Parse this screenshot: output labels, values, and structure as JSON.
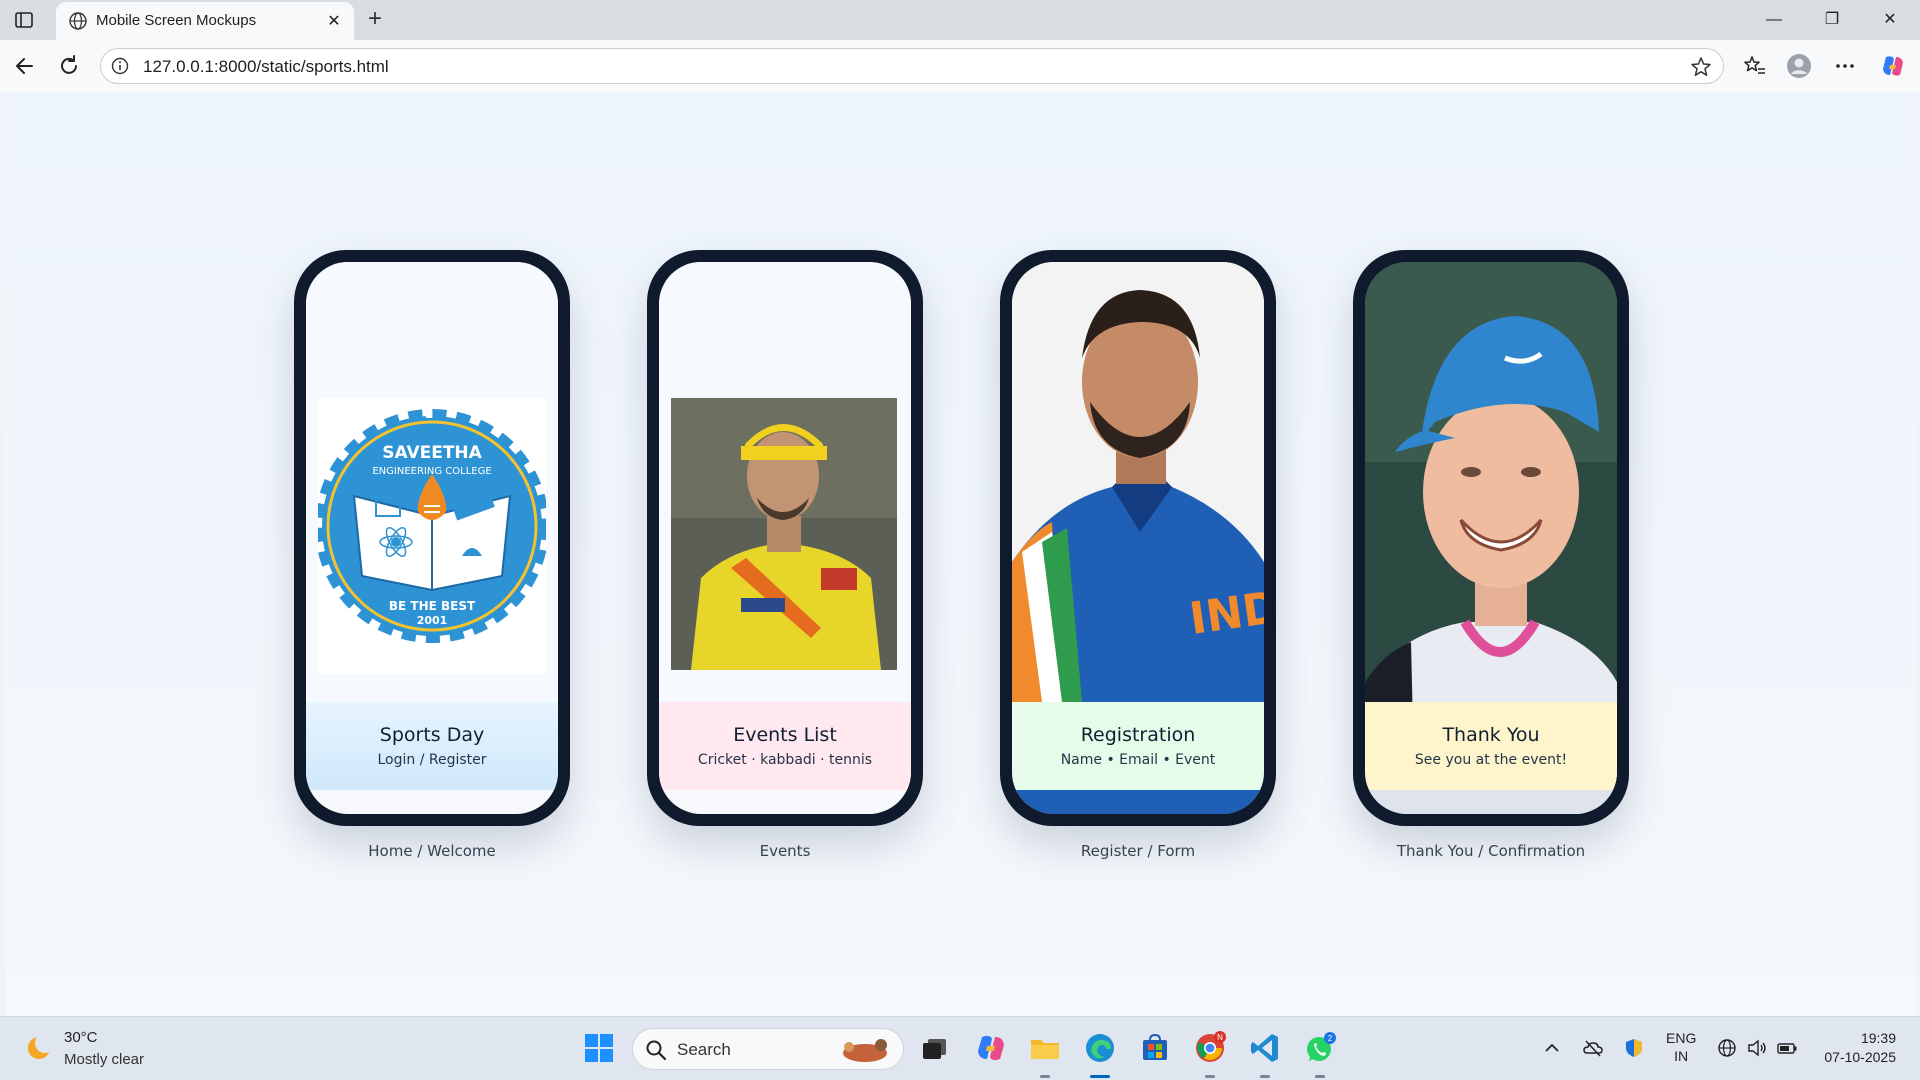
{
  "browser": {
    "tab_title": "Mobile Screen Mockups",
    "url": "127.0.0.1:8000/static/sports.html"
  },
  "screens": [
    {
      "title": "Sports Day",
      "subtitle": "Login / Register",
      "label": "Home / Welcome",
      "caption_bg": "#d4ecfb"
    },
    {
      "title": "Events List",
      "subtitle": "Cricket · kabbadi · tennis",
      "label": "Events",
      "caption_bg": "#ffe8ef"
    },
    {
      "title": "Registration",
      "subtitle": "Name • Email • Event",
      "label": "Register / Form",
      "caption_bg": "#e6fbe9"
    },
    {
      "title": "Thank You",
      "subtitle": "See you at the event!",
      "label": "Thank You / Confirmation",
      "caption_bg": "#fff5cc"
    }
  ],
  "logo": {
    "line1": "SAVEETHA",
    "line2": "ENGINEERING COLLEGE",
    "motto": "BE THE BEST",
    "year": "2001"
  },
  "taskbar": {
    "weather_temp": "30°C",
    "weather_desc": "Mostly clear",
    "search_placeholder": "Search",
    "lang_line1": "ENG",
    "lang_line2": "IN",
    "time": "19:39",
    "date": "07-10-2025",
    "chrome_badge": "N",
    "whatsapp_badge": "2"
  },
  "colors": {
    "phone_frame": "#0f1a2c",
    "page_bg": "#eef4fc",
    "logo_blue": "#2e93d4",
    "logo_orange": "#ef8a23"
  },
  "icons": {
    "browser": [
      "sidebar-icon",
      "globe-icon",
      "close-icon",
      "plus-icon",
      "minimize-icon",
      "maximize-icon",
      "window-close-icon",
      "back-icon",
      "refresh-icon",
      "info-icon",
      "star-icon",
      "favorites-icon",
      "profile-icon",
      "more-icon",
      "copilot-icon"
    ],
    "taskbar": [
      "weather-icon",
      "windows-start-icon",
      "search-icon",
      "task-view-icon",
      "copilot-app-icon",
      "file-explorer-icon",
      "edge-icon",
      "store-icon",
      "chrome-icon",
      "vscode-icon",
      "whatsapp-icon"
    ]
  }
}
